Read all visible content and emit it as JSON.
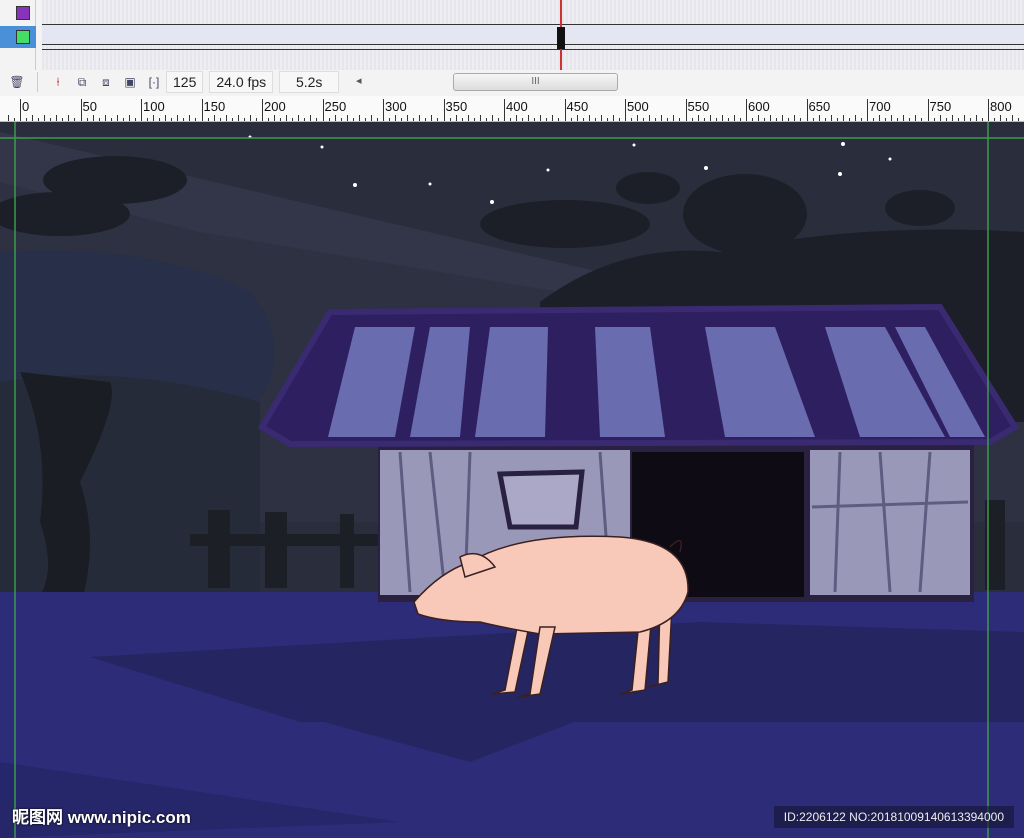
{
  "timeline": {
    "layers": [
      {
        "color": "#8833bb"
      },
      {
        "color": "#44dd66"
      }
    ],
    "current_frame": "125",
    "fps": "24.0 fps",
    "elapsed": "5.2s",
    "scroll_left": "◂",
    "scroll_grip": "III"
  },
  "ruler": {
    "labels": [
      "0",
      "50",
      "100",
      "150",
      "200",
      "250",
      "300",
      "350",
      "400",
      "450",
      "500",
      "550",
      "600",
      "650",
      "700",
      "750",
      "800"
    ]
  },
  "watermark": {
    "left": "昵图网 www.nipic.com",
    "right": "ID:2206122 NO:20181009140613394000"
  }
}
